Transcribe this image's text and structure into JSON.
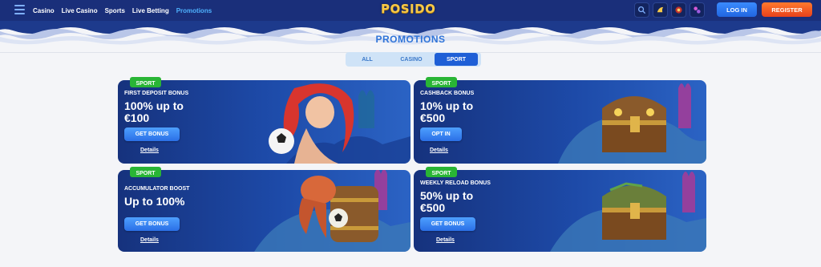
{
  "header": {
    "menu_icon": "hamburger-menu-icon",
    "nav": [
      "Casino",
      "Live Casino",
      "Sports",
      "Live Betting",
      "Promotions"
    ],
    "active_nav": "Promotions",
    "logo": "POSIDO",
    "icons": [
      "search-icon",
      "sportsbook-icon",
      "casino-icon",
      "live-casino-icon"
    ],
    "login_label": "LOG IN",
    "register_label": "REGISTER"
  },
  "page": {
    "title": "PROMOTIONS",
    "tabs": [
      "ALL",
      "CASINO",
      "SPORT"
    ],
    "active_tab": "SPORT"
  },
  "promotions": [
    {
      "badge": "SPORT",
      "title": "FIRST DEPOSIT BONUS",
      "offer_line1": "100% up to",
      "offer_line2": "€100",
      "button": "GET BONUS",
      "details": "Details"
    },
    {
      "badge": "SPORT",
      "title": "CASHBACK BONUS",
      "offer_line1": "10% up to",
      "offer_line2": "€500",
      "button": "OPT IN",
      "details": "Details"
    },
    {
      "badge": "SPORT",
      "title": "ACCUMULATOR BOOST",
      "offer_line1": "Up to 100%",
      "offer_line2": "",
      "button": "GET BONUS",
      "details": "Details"
    },
    {
      "badge": "SPORT",
      "title": "WEEKLY RELOAD BONUS",
      "offer_line1": "50% up to",
      "offer_line2": "€500",
      "button": "GET BONUS",
      "details": "Details"
    }
  ],
  "colors": {
    "topbar": "#1a2f7a",
    "accent_blue": "#2f74d8",
    "badge_green": "#29b535",
    "register_orange": "#e8411c",
    "active_tab": "#1f5fd6"
  }
}
